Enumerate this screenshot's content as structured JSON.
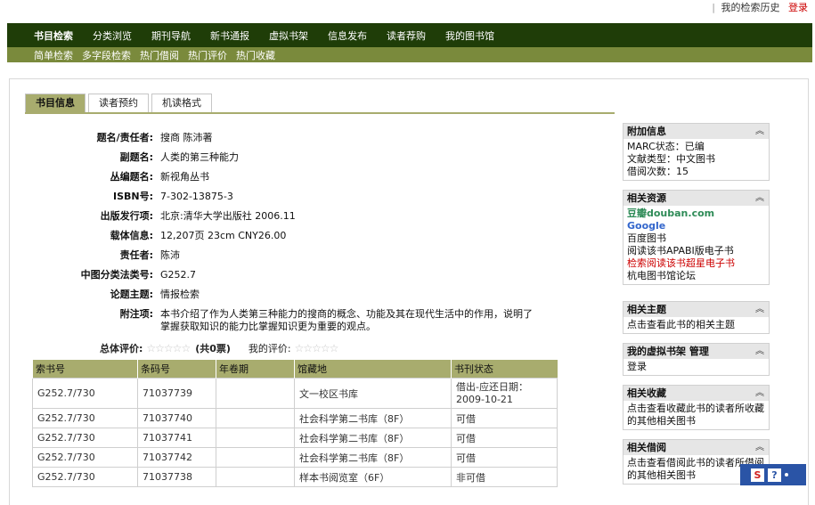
{
  "topbar": {
    "history": "我的检索历史",
    "login": "登录"
  },
  "nav": {
    "items": [
      "书目检索",
      "分类浏览",
      "期刊导航",
      "新书通报",
      "虚拟书架",
      "信息发布",
      "读者荐购",
      "我的图书馆"
    ]
  },
  "subnav": {
    "items": [
      "简单检索",
      "多字段检索",
      "热门借阅",
      "热门评价",
      "热门收藏"
    ]
  },
  "tabs": [
    "书目信息",
    "读者预约",
    "机读格式"
  ],
  "fields": [
    {
      "label": "题名/责任者:",
      "value": "搜商 陈沛著"
    },
    {
      "label": "副题名:",
      "value": "人类的第三种能力"
    },
    {
      "label": "丛编题名:",
      "value": "新视角丛书"
    },
    {
      "label": "ISBN号:",
      "value": "7-302-13875-3"
    },
    {
      "label": "出版发行项:",
      "value": "北京:清华大学出版社 2006.11"
    },
    {
      "label": "载体信息:",
      "value": "12,207页 23cm CNY26.00"
    },
    {
      "label": "责任者:",
      "value": "陈沛"
    },
    {
      "label": "中图分类法类号:",
      "value": "G252.7"
    },
    {
      "label": "论题主题:",
      "value": "情报检索"
    },
    {
      "label": "附注项:",
      "value": "本书介绍了作为人类第三种能力的搜商的概念、功能及其在现代生活中的作用，说明了掌握获取知识的能力比掌握知识更为重要的观点。"
    }
  ],
  "rating": {
    "total_label": "总体评价:",
    "count": "(共0票)",
    "my_label": "我的评价:",
    "stars": "☆☆☆☆☆"
  },
  "holdings": {
    "headers": [
      "索书号",
      "条码号",
      "年卷期",
      "馆藏地",
      "书刊状态"
    ],
    "rows": [
      [
        "G252.7/730",
        "71037739",
        "",
        "文一校区书库",
        "借出-应还日期：2009-10-21"
      ],
      [
        "G252.7/730",
        "71037740",
        "",
        "社会科学第二书库（8F）",
        "可借"
      ],
      [
        "G252.7/730",
        "71037741",
        "",
        "社会科学第二书库（8F）",
        "可借"
      ],
      [
        "G252.7/730",
        "71037742",
        "",
        "社会科学第二书库（8F）",
        "可借"
      ],
      [
        "G252.7/730",
        "71037738",
        "",
        "样本书阅览室（6F）",
        "非可借"
      ]
    ]
  },
  "sidebar": {
    "extra": {
      "title": "附加信息",
      "lines": [
        "MARC状态：已编",
        "文献类型：中文图书",
        "借阅次数：15"
      ]
    },
    "resources": {
      "title": "相关资源",
      "douban": "豆瓣douban.com",
      "google": "Google",
      "links": [
        "百度图书",
        "阅读该书APABI版电子书"
      ],
      "red_link": "检索阅读该书超星电子书",
      "forum": "杭电图书馆论坛"
    },
    "topics": {
      "title": "相关主题",
      "text": "点击查看此书的相关主题"
    },
    "shelf": {
      "title": "我的虚拟书架 管理",
      "text": "登录"
    },
    "collect": {
      "title": "相关收藏",
      "text": "点击查看收藏此书的读者所收藏的其他相关图书"
    },
    "borrow": {
      "title": "相关借阅",
      "text": "点击查看借阅此书的读者所借阅的其他相关图书"
    },
    "chevron": "︽"
  },
  "float_bar": {
    "s": "S",
    "q": "?"
  }
}
